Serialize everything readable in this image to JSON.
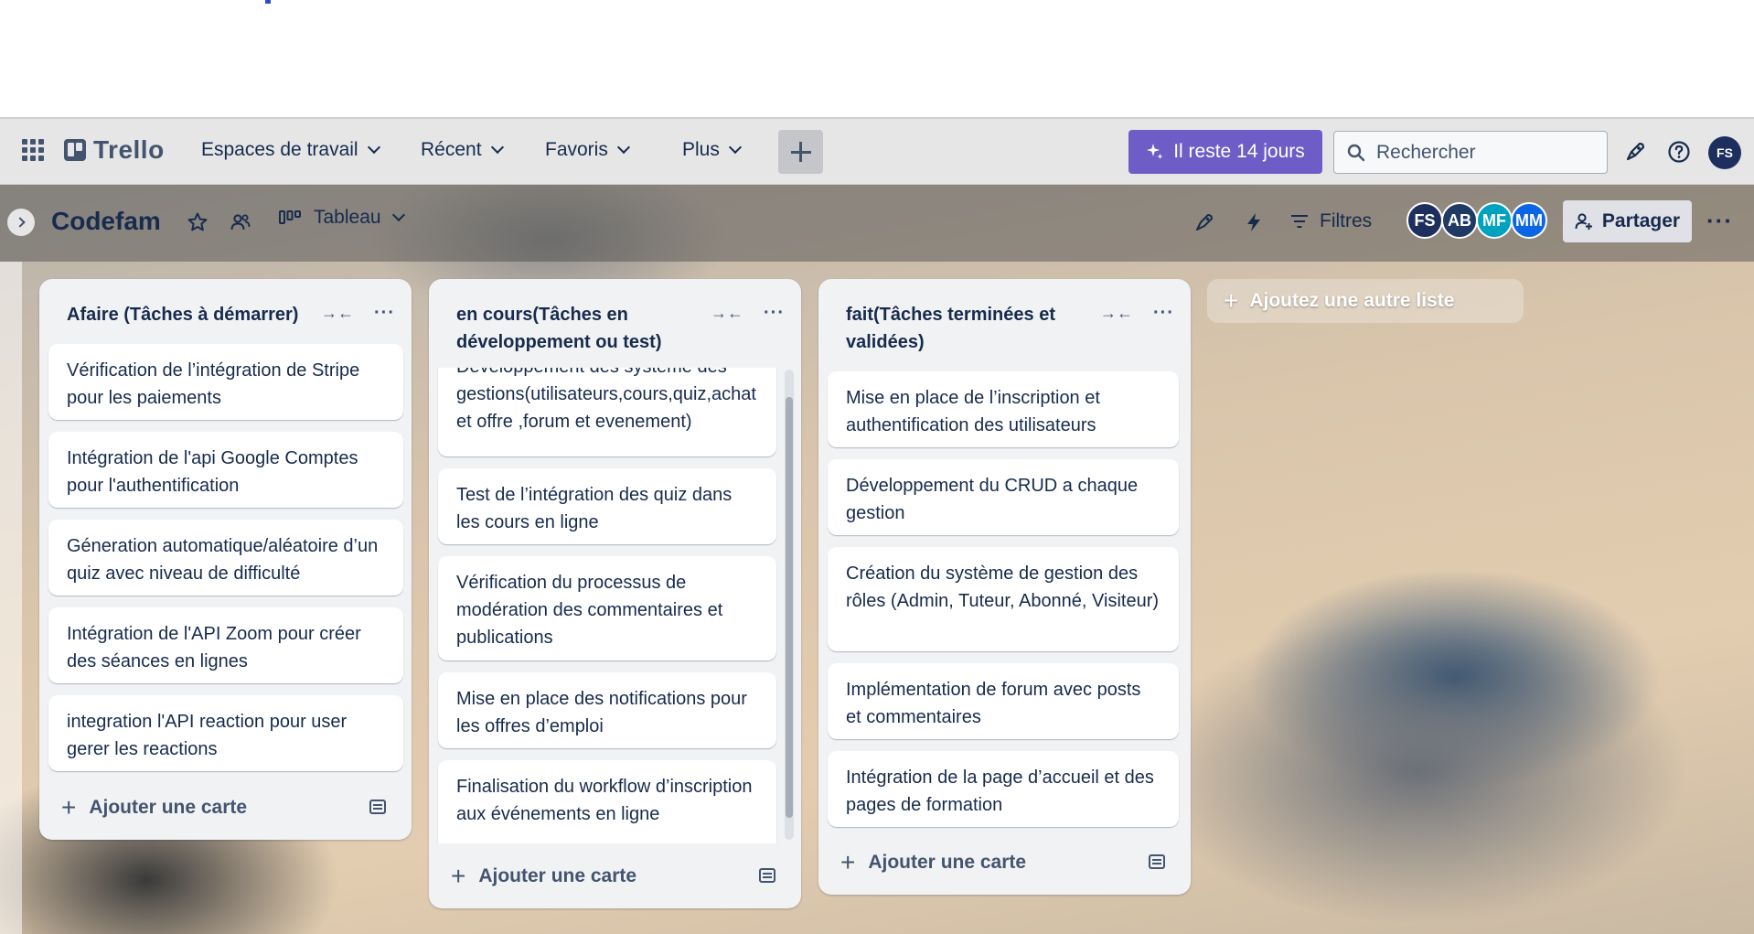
{
  "header": {
    "logo": "Trello",
    "nav": [
      {
        "label": "Espaces de travail"
      },
      {
        "label": "Récent"
      },
      {
        "label": "Favoris"
      },
      {
        "label": "Plus"
      }
    ],
    "trial_label": "Il reste 14 jours",
    "search_placeholder": "Rechercher",
    "user_initials": "FS"
  },
  "board": {
    "title": "Codefam",
    "view_label": "Tableau",
    "filters_label": "Filtres",
    "share_label": "Partager",
    "members": [
      {
        "initials": "FS",
        "color": "#1d2f5e"
      },
      {
        "initials": "AB",
        "color": "#1f3a63"
      },
      {
        "initials": "MF",
        "color": "#00a3bf"
      },
      {
        "initials": "MM",
        "color": "#0c66e4"
      }
    ],
    "add_list_label": "Ajoutez une autre liste"
  },
  "lists": [
    {
      "title": "Afaire (Tâches à démarrer)",
      "cards": [
        "Vérification de l’intégration de Stripe pour les paiements",
        "Intégration de l'api Google Comptes pour l'authentification",
        "Géneration automatique/aléatoire d’un quiz avec niveau de difficulté",
        "Intégration de l'API Zoom pour créer des séances en lignes",
        "integration l'API reaction pour user gerer les reactions"
      ],
      "add_card_label": "Ajouter une carte"
    },
    {
      "title": "en cours(Tâches en développement ou test)",
      "cards": [
        "Développement des système des gestions(utilisateurs,cours,quiz,achat et offre ,forum et evenement)",
        "Test de l’intégration des quiz dans les cours en ligne",
        "Vérification du processus de modération des commentaires et publications",
        "Mise en place des notifications pour les offres d’emploi",
        "Finalisation du workflow d’inscription aux événements en ligne"
      ],
      "add_card_label": "Ajouter une carte"
    },
    {
      "title": "fait(Tâches terminées et validées)",
      "cards": [
        "Mise en place de l’inscription et authentification des utilisateurs",
        "Développement du CRUD a chaque gestion",
        "Création du système de gestion des rôles (Admin, Tuteur, Abonné, Visiteur)",
        "Implémentation de forum avec posts et commentaires",
        "Intégration de la page d’accueil et des pages de formation"
      ],
      "add_card_label": "Ajouter une carte"
    }
  ],
  "colors": {
    "accent": "#6e5dc6",
    "header_bg": "#e6e6e6",
    "list_bg": "#f1f2f4",
    "text": "#172b4d"
  }
}
